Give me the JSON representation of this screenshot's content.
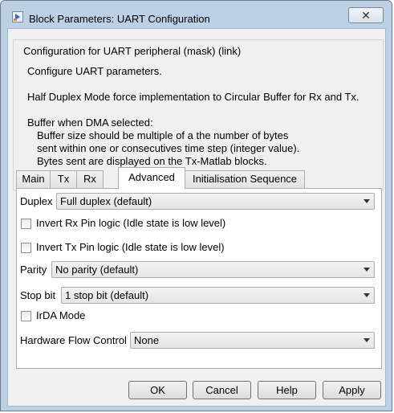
{
  "window": {
    "title": "Block Parameters: UART Configuration",
    "close_label": "✕"
  },
  "group": {
    "legend": "Configuration for UART peripheral (mask) (link)",
    "lines": [
      "Configure UART parameters.",
      "Half Duplex Mode force implementation to Circular Buffer for Rx and Tx.",
      "Buffer when DMA selected:",
      "Buffer size should be multiple of a the number of bytes",
      "sent within one or consecutives time step (integer value).",
      "Bytes sent are displayed on the Tx-Matlab blocks."
    ]
  },
  "tabs": [
    {
      "label": "Main"
    },
    {
      "label": "Tx"
    },
    {
      "label": "Rx"
    },
    {
      "label": "Advanced",
      "active": true
    },
    {
      "label": "Initialisation Sequence"
    }
  ],
  "advanced": {
    "duplex": {
      "label": "Duplex",
      "value": "Full duplex (default)"
    },
    "invert_rx": {
      "label": "Invert Rx Pin logic (Idle state is low level)",
      "checked": false
    },
    "invert_tx": {
      "label": "Invert Tx Pin logic (Idle state is low level)",
      "checked": false
    },
    "parity": {
      "label": "Parity",
      "value": "No parity (default)"
    },
    "stop_bit": {
      "label": "Stop bit",
      "value": "1 stop bit (default)"
    },
    "irda": {
      "label": "IrDA Mode",
      "checked": false
    },
    "flow_control": {
      "label": "Hardware Flow Control",
      "value": "None"
    }
  },
  "buttons": {
    "ok": "OK",
    "cancel": "Cancel",
    "help": "Help",
    "apply": "Apply"
  }
}
